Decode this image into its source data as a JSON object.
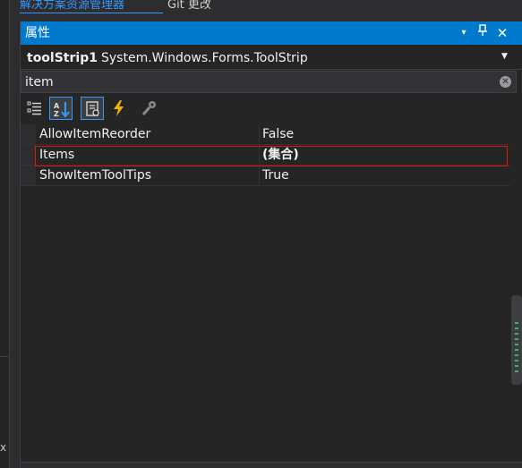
{
  "top_tabs": {
    "active_label": "解决方案资源管理器",
    "inactive_label": "Git 更改"
  },
  "panel": {
    "title": "属性",
    "title_buttons": {
      "dropdown": "▾",
      "pin": "📌",
      "close": "✕"
    }
  },
  "object_selector": {
    "name": "toolStrip1",
    "type": "System.Windows.Forms.ToolStrip"
  },
  "search": {
    "value": "item",
    "clear_glyph": "✕"
  },
  "toolbar": {
    "icons": [
      "categorized-icon",
      "alphabetical-icon",
      "properties-icon",
      "events-icon",
      "property-pages-icon"
    ],
    "checked": [
      "alphabetical-icon",
      "properties-icon"
    ]
  },
  "properties": [
    {
      "name": "AllowItemReorder",
      "value": "False",
      "bold": false
    },
    {
      "name": "Items",
      "value": "(集合)",
      "bold": true
    },
    {
      "name": "ShowItemToolTips",
      "value": "True",
      "bold": false
    }
  ],
  "left_edge": {
    "close_glyph": "x"
  },
  "colors": {
    "accent": "#007acc",
    "highlight_border": "#e51400",
    "active_tab": "#3399ff",
    "background": "#252526"
  }
}
